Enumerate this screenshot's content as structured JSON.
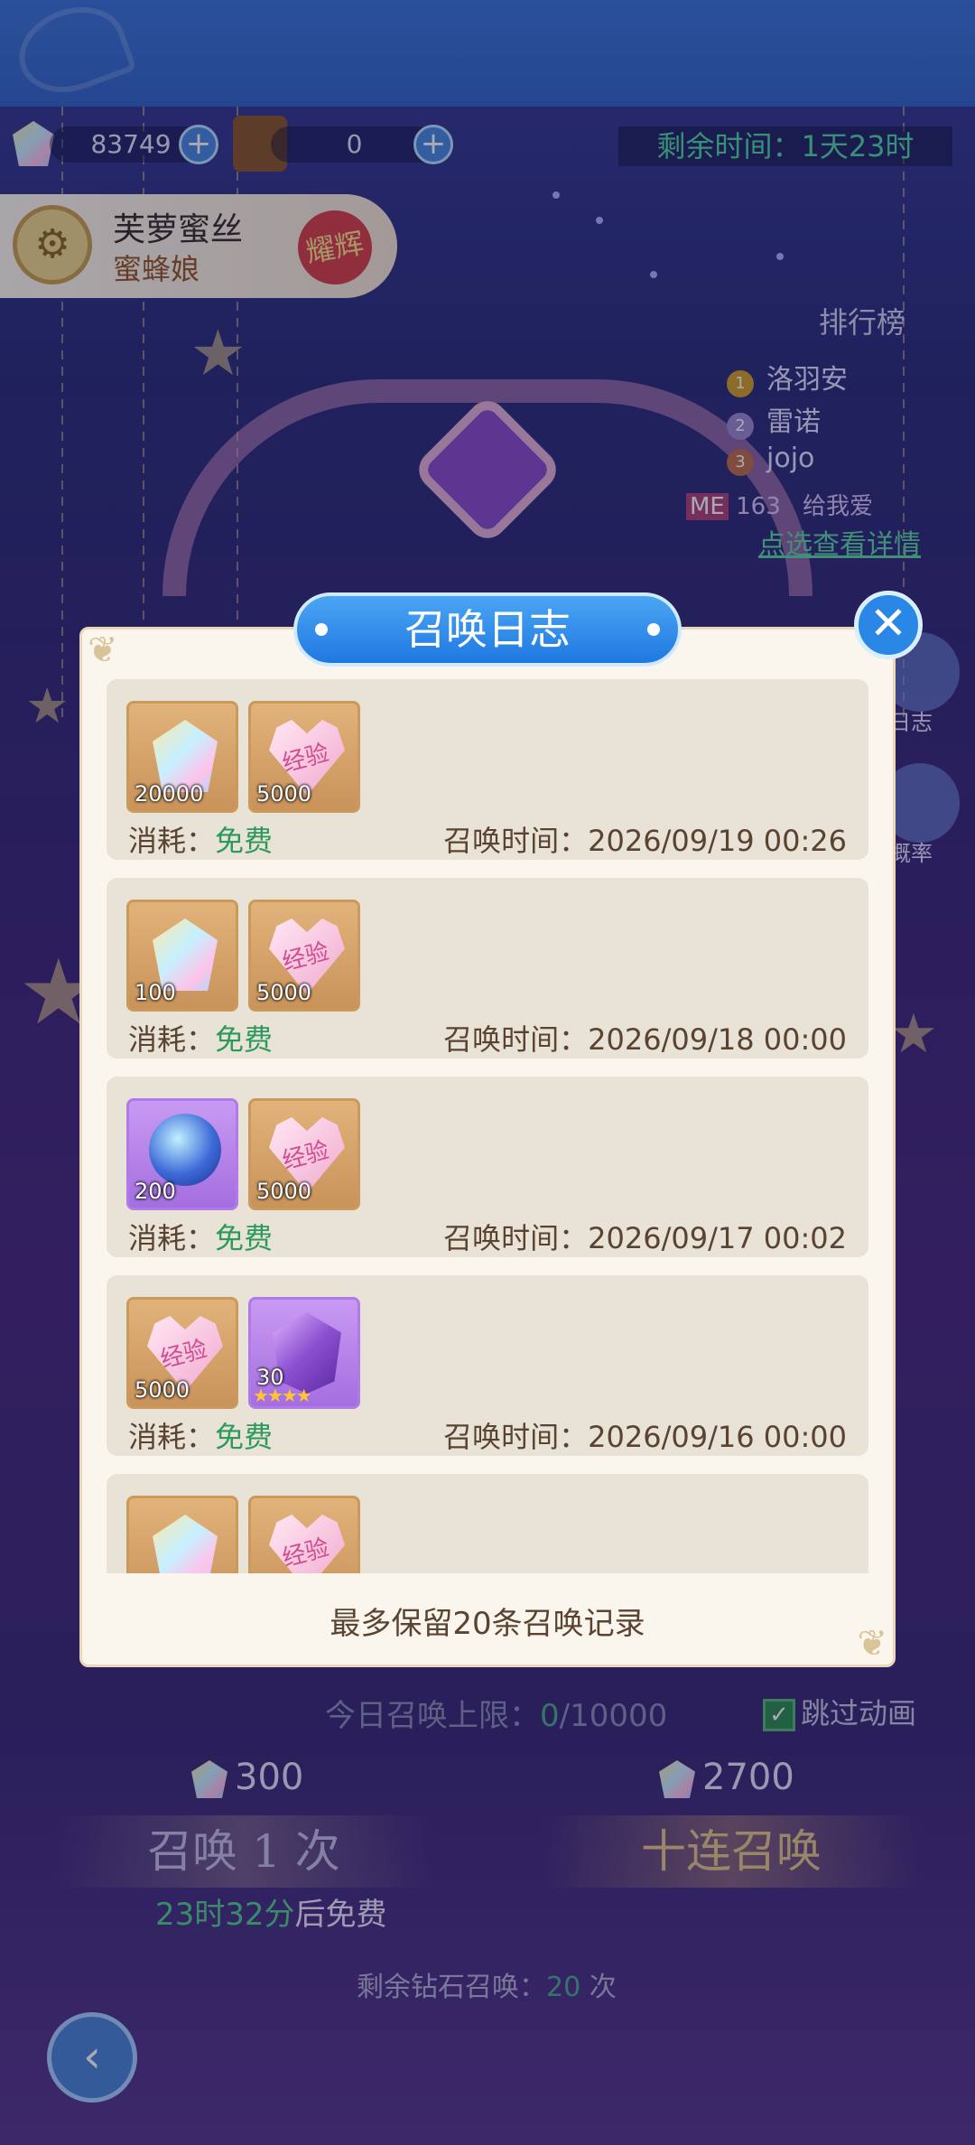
{
  "hud": {
    "diamond_count": "83749",
    "ticket_count": "0",
    "remaining_time": "剩余时间：1天23时"
  },
  "hero": {
    "name": "芙萝蜜丝",
    "subtitle": "蜜蜂娘",
    "tag": "耀辉"
  },
  "ranking": {
    "title": "排行榜",
    "entries": [
      {
        "rank": "1",
        "name": "洛羽安"
      },
      {
        "rank": "2",
        "name": "雷诺"
      },
      {
        "rank": "3",
        "name": "jojo"
      }
    ],
    "me_label": "ME",
    "me_rank": "163",
    "me_name": "给我爱",
    "detail_link": "点选查看详情"
  },
  "side_buttons": {
    "log": "日志",
    "rate": "概率"
  },
  "dialog": {
    "title": "召唤日志",
    "cost_prefix": "消耗：",
    "time_prefix": "召唤时间：",
    "entries": [
      {
        "items": [
          {
            "type": "diamond",
            "qty": "20000"
          },
          {
            "type": "exp-heart",
            "qty": "5000"
          }
        ],
        "cost": "免费",
        "time": "2026/09/19 00:26"
      },
      {
        "items": [
          {
            "type": "diamond",
            "qty": "100"
          },
          {
            "type": "exp-heart",
            "qty": "5000"
          }
        ],
        "cost": "免费",
        "time": "2026/09/18 00:00"
      },
      {
        "items": [
          {
            "type": "crystal-orb",
            "qty": "200"
          },
          {
            "type": "exp-heart",
            "qty": "5000"
          }
        ],
        "cost": "免费",
        "time": "2026/09/17 00:02"
      },
      {
        "items": [
          {
            "type": "exp-heart",
            "qty": "5000"
          },
          {
            "type": "purple-crystal",
            "qty": "30",
            "stars": "★★★★"
          }
        ],
        "cost": "免费",
        "time": "2026/09/16 00:00"
      },
      {
        "items": [
          {
            "type": "diamond",
            "qty": ""
          },
          {
            "type": "exp-heart",
            "qty": ""
          }
        ],
        "cost": "",
        "time": ""
      }
    ],
    "exp_label": "经验",
    "footer": "最多保留20条召唤记录"
  },
  "summon": {
    "daily_limit_prefix": "今日召唤上限：",
    "daily_limit_value": "0",
    "daily_limit_total": "/10000",
    "skip_label": "跳过动画",
    "skip_checked": true,
    "single_cost": "300",
    "ten_cost": "2700",
    "single_label": "召唤 1 次",
    "ten_label": "十连召唤",
    "free_timer_value": "23时32分",
    "free_timer_suffix": "后免费",
    "remaining_prefix": "剩余钻石召唤：",
    "remaining_value": "20",
    "remaining_suffix": "次"
  },
  "colors": {
    "accent_blue": "#1f78e0",
    "free_green": "#2b9a5a",
    "panel_bg": "#faf6ee",
    "entry_bg": "#e9e2d6",
    "text_brown": "#5a4431"
  },
  "icons": {
    "close": "close-icon",
    "back": "back-arrow-icon",
    "plus": "plus-icon"
  }
}
